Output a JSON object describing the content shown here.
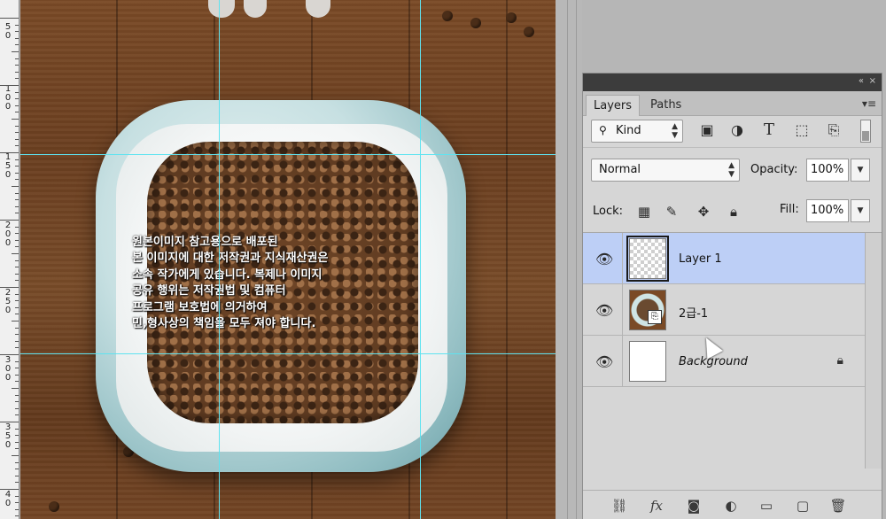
{
  "ruler": {
    "labels": [
      {
        "text": "5\n0"
      },
      {
        "text": "1\n0\n0"
      },
      {
        "text": "1\n5\n0"
      },
      {
        "text": "2\n0\n0"
      },
      {
        "text": "2\n5\n0"
      },
      {
        "text": "3\n0\n0"
      },
      {
        "text": "3\n5\n0"
      },
      {
        "text": "4\n0"
      }
    ]
  },
  "canvas": {
    "watermark": [
      "원본이미지 참고용으로 배포된",
      "본 이미지에 대한 저작권과 지식재산권은",
      "소속 작가에게 있습니다. 복제나 이미지",
      "공유 행위는 저작권법 및 컴퓨터",
      "프로그램 보호법에 의거하여",
      "민,형사상의 책임을 모두 져야 합니다."
    ]
  },
  "panel": {
    "collapse_icon": "«",
    "close_icon": "×",
    "tabs": [
      {
        "label": "Layers",
        "active": true
      },
      {
        "label": "Paths",
        "active": false
      }
    ],
    "menu_icon": "▾≡",
    "filter": {
      "kind_label": "Kind",
      "icons": [
        "image-filter-icon",
        "adjustment-filter-icon",
        "type-filter-icon",
        "shape-filter-icon",
        "smart-object-filter-icon"
      ]
    },
    "blend_mode": "Normal",
    "opacity_label": "Opacity:",
    "opacity_value": "100%",
    "lock_label": "Lock:",
    "fill_label": "Fill:",
    "fill_value": "100%",
    "layers": [
      {
        "name": "Layer 1",
        "selected": true,
        "thumb": "transparent",
        "locked": false,
        "italic": false
      },
      {
        "name": "2급-1",
        "selected": false,
        "thumb": "photo",
        "locked": false,
        "italic": false,
        "smart_object": true
      },
      {
        "name": "Background",
        "selected": false,
        "thumb": "white",
        "locked": true,
        "italic": true
      }
    ],
    "footer_icons": [
      "link-layers-icon",
      "fx-icon",
      "add-mask-icon",
      "adjustment-layer-icon",
      "new-group-icon",
      "new-layer-icon",
      "trash-icon"
    ]
  },
  "colors": {
    "guide": "#5fe3f0",
    "selected_layer": "#bdcff6",
    "panel_bg": "#d6d6d6"
  }
}
